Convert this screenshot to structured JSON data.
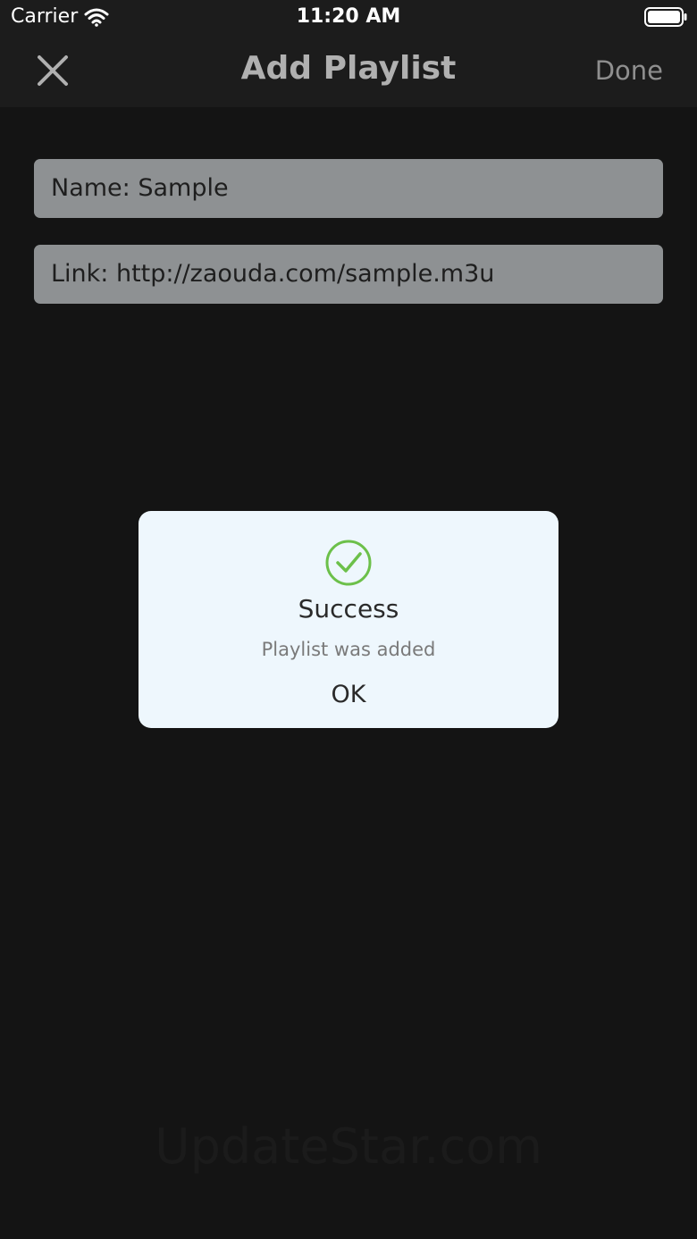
{
  "status_bar": {
    "carrier": "Carrier",
    "time": "11:20 AM",
    "icons": [
      "wifi-icon",
      "battery-icon"
    ]
  },
  "nav": {
    "title": "Add Playlist",
    "close_icon": "close-icon",
    "done_label": "Done"
  },
  "form": {
    "name_field": "Name: Sample",
    "link_field": "Link: http://zaouda.com/sample.m3u"
  },
  "dialog": {
    "icon": "checkmark-circle-icon",
    "title": "Success",
    "message": "Playlist was added",
    "ok_label": "OK"
  },
  "watermark": {
    "text": "UpdateStar.com"
  },
  "colors": {
    "background": "#141414",
    "bar": "#1c1c1c",
    "field": "#8e9193",
    "dialog": "#eef7fd",
    "success_green": "#6cc04a"
  }
}
